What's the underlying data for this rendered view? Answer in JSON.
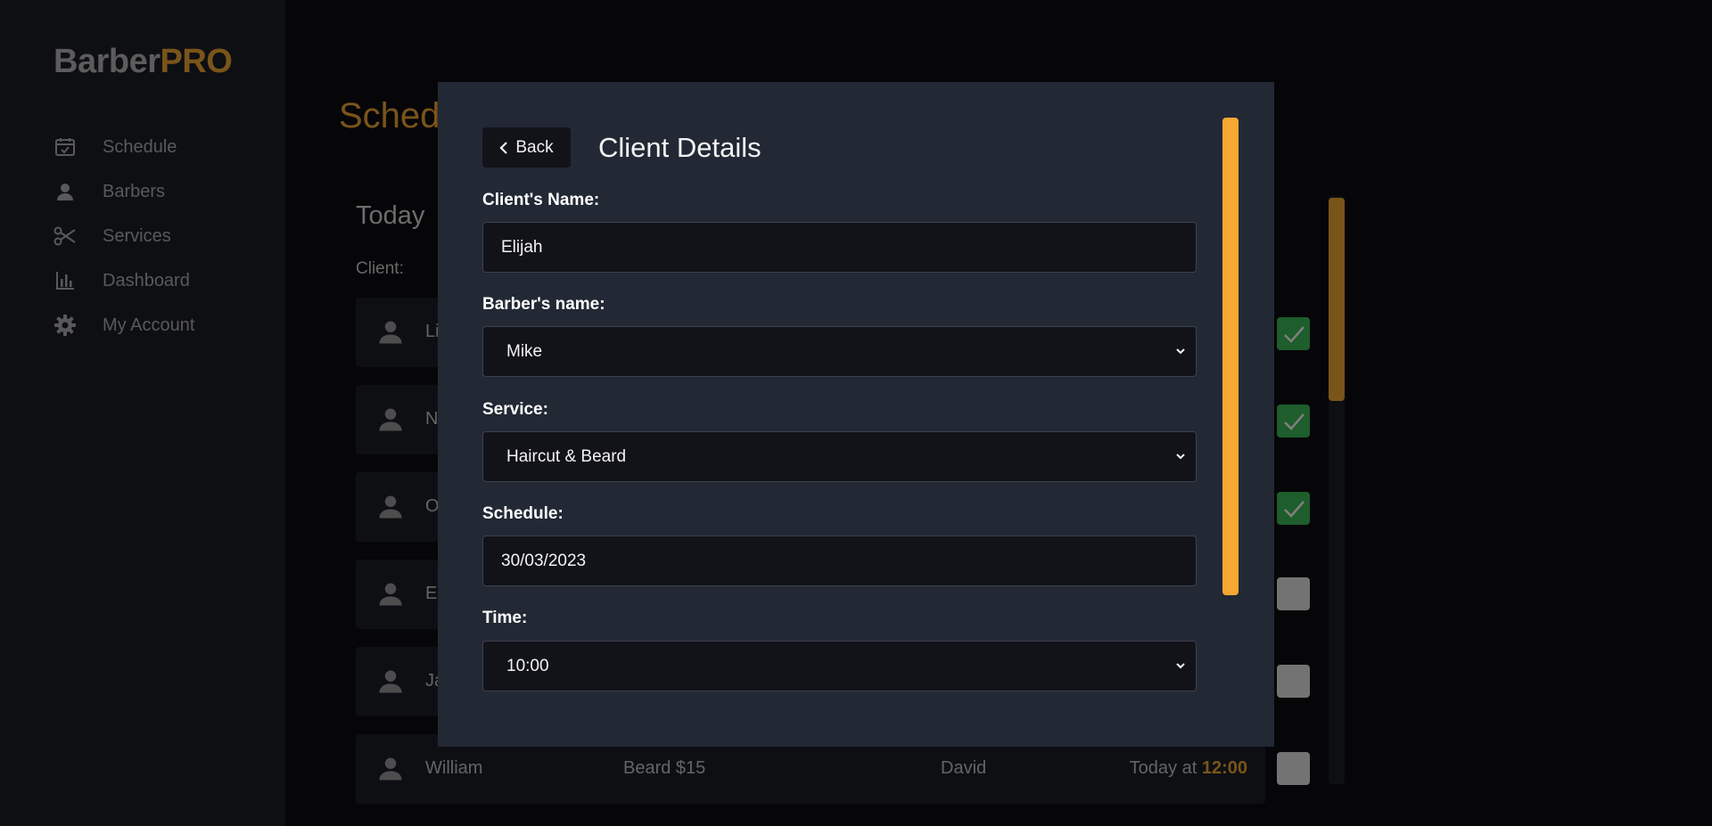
{
  "brand": {
    "part1": "Barber",
    "part2": "PRO"
  },
  "sidebar": {
    "items": [
      {
        "label": "Schedule",
        "icon": "calendar-check-icon"
      },
      {
        "label": "Barbers",
        "icon": "user-icon"
      },
      {
        "label": "Services",
        "icon": "scissors-icon"
      },
      {
        "label": "Dashboard",
        "icon": "bar-chart-icon"
      },
      {
        "label": "My Account",
        "icon": "gear-icon"
      }
    ]
  },
  "main": {
    "page_title": "Sched",
    "section_title": "Today",
    "client_col_label": "Client:",
    "rows": [
      {
        "name": "Li",
        "service": "",
        "barber": "",
        "when_prefix": "",
        "when_time": "",
        "done": true
      },
      {
        "name": "N",
        "service": "",
        "barber": "",
        "when_prefix": "",
        "when_time": "",
        "done": true
      },
      {
        "name": "O",
        "service": "",
        "barber": "",
        "when_prefix": "",
        "when_time": "",
        "done": true
      },
      {
        "name": "El",
        "service": "",
        "barber": "",
        "when_prefix": "",
        "when_time": "",
        "done": false
      },
      {
        "name": "Ja",
        "service": "",
        "barber": "",
        "when_prefix": "",
        "when_time": "",
        "done": false
      },
      {
        "name": "William",
        "service": "Beard  $15",
        "barber": "David",
        "when_prefix": "Today at ",
        "when_time": "12:00",
        "done": false
      }
    ]
  },
  "modal": {
    "back_label": "Back",
    "title": "Client Details",
    "fields": {
      "client_name": {
        "label": "Client's Name:",
        "value": "Elijah"
      },
      "barber_name": {
        "label": "Barber's name:",
        "value": "Mike"
      },
      "service": {
        "label": "Service:",
        "value": "Haircut & Beard"
      },
      "schedule": {
        "label": "Schedule:",
        "value": "30/03/2023"
      },
      "time": {
        "label": "Time:",
        "value": "10:00"
      }
    }
  },
  "colors": {
    "accent": "#f5a833",
    "done": "#3cbb59",
    "panel": "#222834",
    "sidebar": "#1b1f27"
  }
}
